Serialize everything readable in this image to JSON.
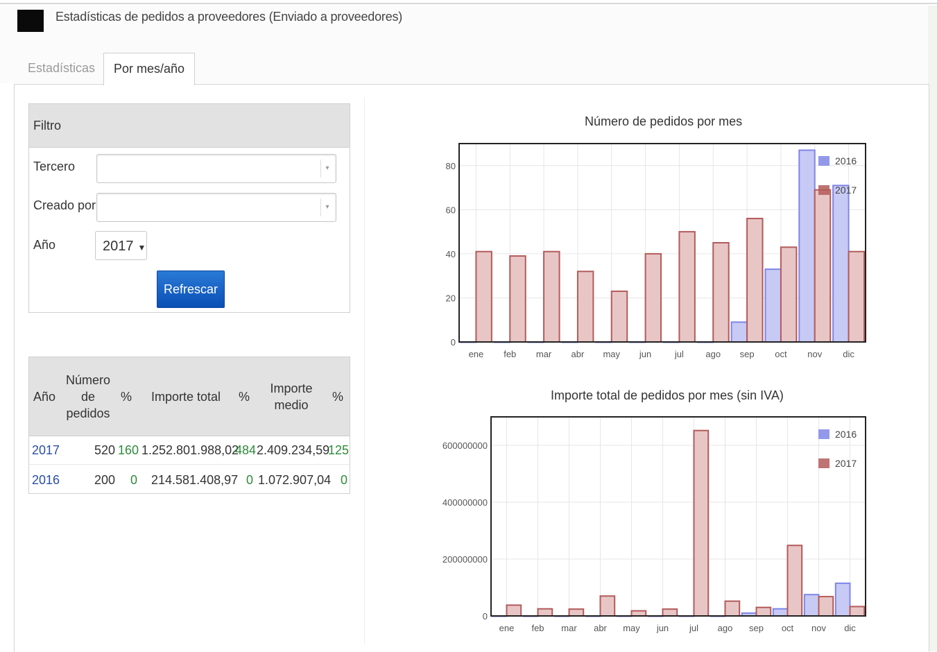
{
  "header": {
    "title": "Estadísticas de pedidos a proveedores (Enviado a proveedores)"
  },
  "tabs": [
    {
      "label": "Estadísticas"
    },
    {
      "label": "Por mes/año"
    }
  ],
  "filter": {
    "title": "Filtro",
    "tercero_label": "Tercero",
    "tercero_value": "",
    "creado_label": "Creado por",
    "creado_value": "",
    "anio_label": "Año",
    "anio_value": "2017",
    "refresh_label": "Refrescar"
  },
  "stats_table": {
    "headers": {
      "anio": "Año",
      "num_a": "Número",
      "num_b": "de",
      "num_c": "pedidos",
      "pct1": "%",
      "importe_total": "Importe total",
      "pct2": "%",
      "importe_medio_a": "Importe",
      "importe_medio_b": "medio",
      "pct3": "%"
    },
    "rows": [
      {
        "anio": "2017",
        "num": "520",
        "pct1": "160",
        "total": "1.252.801.988,02",
        "pct2": "484",
        "medio": "2.409.234,59",
        "pct3": "125"
      },
      {
        "anio": "2016",
        "num": "200",
        "pct1": "0",
        "total": "214.581.408,97",
        "pct2": "0",
        "medio": "1.072.907,04",
        "pct3": "0"
      }
    ]
  },
  "colors": {
    "s2016": "#7f86e6",
    "s2016_fill": "#c7caf4",
    "s2017": "#b45a5a",
    "s2017_fill": "#e8c6c6"
  },
  "chart_data": [
    {
      "type": "bar",
      "title": "Número de pedidos por mes",
      "categories": [
        "ene",
        "feb",
        "mar",
        "abr",
        "may",
        "jun",
        "jul",
        "ago",
        "sep",
        "oct",
        "nov",
        "dic"
      ],
      "series": [
        {
          "name": "2016",
          "values": [
            0,
            0,
            0,
            0,
            0,
            0,
            0,
            0,
            9,
            33,
            87,
            71
          ]
        },
        {
          "name": "2017",
          "values": [
            41,
            39,
            41,
            32,
            23,
            40,
            50,
            45,
            56,
            43,
            69,
            41
          ]
        }
      ],
      "ylim": [
        0,
        90
      ],
      "yticks": [
        "0",
        "20",
        "40",
        "60",
        "80"
      ],
      "ytick_values": [
        0,
        20,
        40,
        60,
        80
      ],
      "legend": "top-right",
      "grid": true
    },
    {
      "type": "bar",
      "title": "Importe total de pedidos por mes (sin IVA)",
      "categories": [
        "ene",
        "feb",
        "mar",
        "abr",
        "may",
        "jun",
        "jul",
        "ago",
        "sep",
        "oct",
        "nov",
        "dic"
      ],
      "series": [
        {
          "name": "2016",
          "values": [
            0,
            0,
            0,
            0,
            0,
            0,
            0,
            0,
            10000000,
            25000000,
            75000000,
            115000000
          ]
        },
        {
          "name": "2017",
          "values": [
            38000000,
            25000000,
            24000000,
            70000000,
            18000000,
            24000000,
            652000000,
            52000000,
            30000000,
            248000000,
            68000000,
            33000000
          ]
        }
      ],
      "ylim": [
        0,
        700000000
      ],
      "yticks": [
        "0",
        "200000000",
        "400000000",
        "600000000"
      ],
      "ytick_values": [
        0,
        200000000,
        400000000,
        600000000
      ],
      "legend": "top-right",
      "grid": true
    }
  ]
}
